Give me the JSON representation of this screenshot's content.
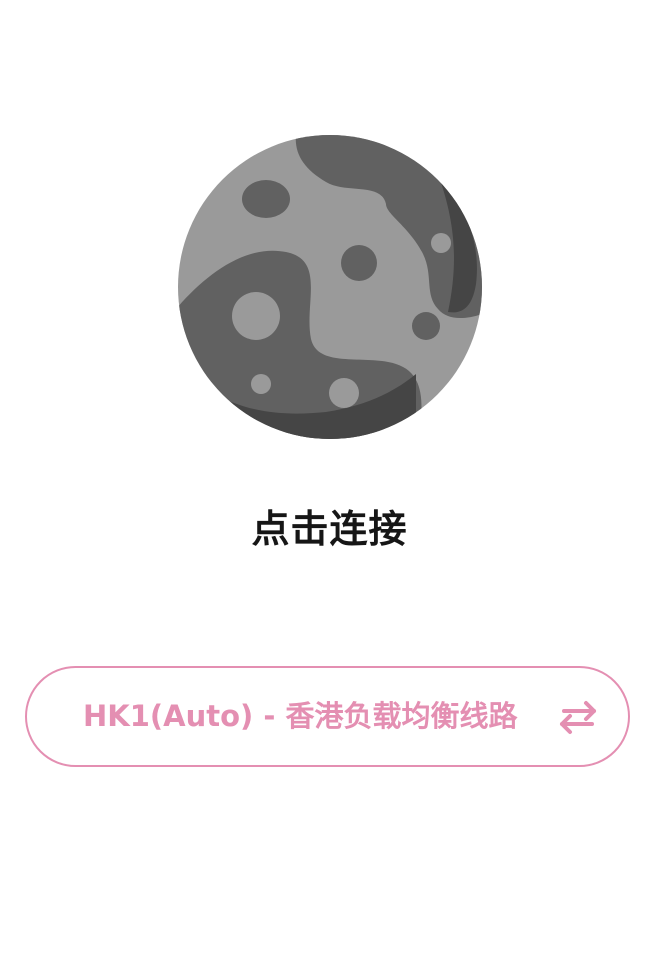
{
  "connect": {
    "label": "点击连接",
    "planet_icon": "planet-icon"
  },
  "server": {
    "label": "HK1(Auto) - 香港负载均衡线路",
    "switch_icon": "swap-arrows-icon"
  },
  "colors": {
    "accent": "#e48fb2",
    "label_text": "#161616",
    "planet_light": "#9a9a9a",
    "planet_dark": "#616161",
    "planet_shadow": "#454545"
  }
}
